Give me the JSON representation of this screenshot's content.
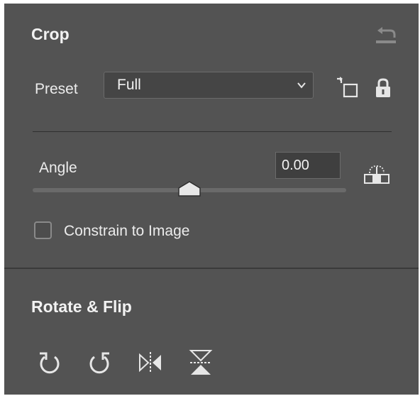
{
  "crop": {
    "title": "Crop",
    "preset_label": "Preset",
    "preset_value": "Full",
    "angle_label": "Angle",
    "angle_value": "0.00",
    "angle_slider_fraction": 0.5,
    "constrain_label": "Constrain to Image",
    "constrain_checked": false
  },
  "rotate_flip": {
    "title": "Rotate & Flip",
    "tools": [
      "rotate-left-icon",
      "rotate-right-icon",
      "flip-horizontal-icon",
      "flip-vertical-icon"
    ]
  },
  "colors": {
    "panel": "#535353",
    "text": "#f0f0f0",
    "icon": "#e6e6e6"
  }
}
